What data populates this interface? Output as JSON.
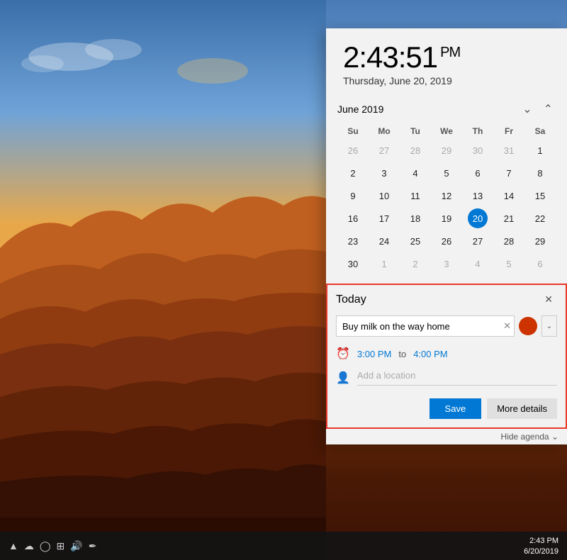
{
  "desktop": {
    "bg_description": "Grand Canyon sunset landscape"
  },
  "clock": {
    "time": "2:43:51",
    "ampm": "PM",
    "date": "Thursday, June 20, 2019"
  },
  "calendar": {
    "month_year": "June 2019",
    "days_header": [
      "Su",
      "Mo",
      "Tu",
      "We",
      "Th",
      "Fr",
      "Sa"
    ],
    "weeks": [
      [
        "26",
        "27",
        "28",
        "29",
        "30",
        "31",
        "1"
      ],
      [
        "2",
        "3",
        "4",
        "5",
        "6",
        "7",
        "8"
      ],
      [
        "9",
        "10",
        "11",
        "12",
        "13",
        "14",
        "15"
      ],
      [
        "16",
        "17",
        "18",
        "19",
        "20",
        "21",
        "22"
      ],
      [
        "23",
        "24",
        "25",
        "26",
        "27",
        "28",
        "29"
      ],
      [
        "30",
        "1",
        "2",
        "3",
        "4",
        "5",
        "6"
      ]
    ],
    "other_month_first_row": [
      true,
      true,
      true,
      true,
      true,
      true,
      false
    ],
    "today_date": "20",
    "today_col": 4,
    "today_row": 3
  },
  "agenda": {
    "title": "Today",
    "close_btn": "✕",
    "event_title": "Buy milk on the way home",
    "time_start": "3:00 PM",
    "time_separator": "to",
    "time_end": "4:00 PM",
    "location_placeholder": "Add a location",
    "save_label": "Save",
    "more_details_label": "More details",
    "hide_agenda_label": "Hide agenda"
  },
  "taskbar": {
    "time": "2:43 PM",
    "date": "6/20/2019",
    "icons": [
      "▲",
      "☁",
      "◯",
      "⊞",
      "🔊",
      "✒"
    ]
  }
}
